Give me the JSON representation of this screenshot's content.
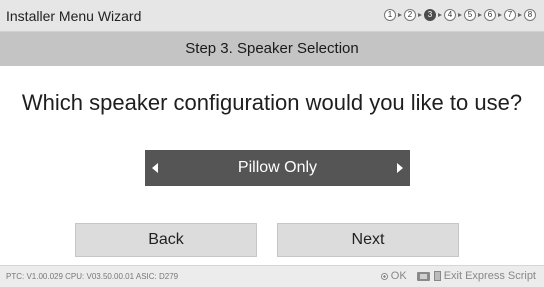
{
  "window": {
    "title": "Installer Menu Wizard"
  },
  "steps": [
    "1",
    "2",
    "3",
    "4",
    "5",
    "6",
    "7",
    "8"
  ],
  "current_step": 3,
  "header": {
    "step_title": "Step 3. Speaker Selection"
  },
  "main": {
    "question": "Which speaker configuration would you like to use?",
    "selector_value": "Pillow Only"
  },
  "buttons": {
    "back": "Back",
    "next": "Next"
  },
  "footer": {
    "version_info": "PTC: V1.00.029 CPU: V03.50.00.01 ASIC: D279",
    "ok_label": "OK",
    "exit_label": "Exit Express Script"
  },
  "icons": {
    "step_arrow": "right-triangle-icon",
    "selector_left": "left-arrow-icon",
    "selector_right": "right-arrow-icon",
    "ok": "ok-button-icon",
    "exit": "exit-key-icon",
    "script": "document-icon"
  },
  "colors": {
    "title_bar": "#e6e6e6",
    "step_header": "#c4c4c4",
    "selector_bg": "#555555",
    "button_bg": "#dcdcdc"
  }
}
